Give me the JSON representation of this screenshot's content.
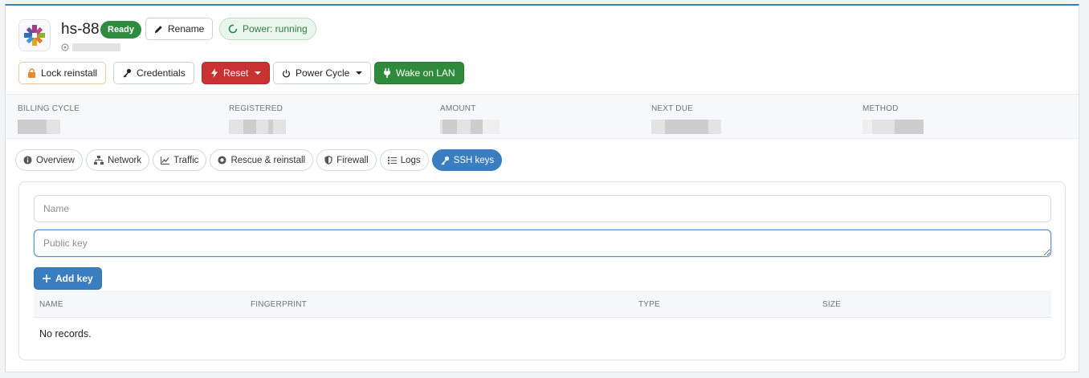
{
  "server": {
    "hostname": "hs-88",
    "status": "Ready",
    "rename_label": "Rename",
    "power_label": "Power: running"
  },
  "actions": {
    "lock_reinstall": "Lock reinstall",
    "credentials": "Credentials",
    "reset": "Reset",
    "power_cycle": "Power Cycle",
    "wake_on_lan": "Wake on LAN"
  },
  "billing": {
    "labels": [
      "BILLING CYCLE",
      "REGISTERED",
      "AMOUNT",
      "NEXT DUE",
      "METHOD"
    ]
  },
  "tabs": [
    "Overview",
    "Network",
    "Traffic",
    "Rescue & reinstall",
    "Firewall",
    "Logs",
    "SSH keys"
  ],
  "active_tab": "SSH keys",
  "ssh_form": {
    "name_placeholder": "Name",
    "key_placeholder": "Public key",
    "add_label": "Add key"
  },
  "table": {
    "columns": [
      "NAME",
      "FINGERPRINT",
      "TYPE",
      "SIZE"
    ],
    "empty_text": "No records."
  },
  "colors": {
    "accent": "#3a7dc0",
    "success": "#2e8b3f",
    "danger": "#c83232",
    "lock_border": "#f0c89a"
  },
  "icons": {
    "logo": "os-logo-icon",
    "rename": "pencil-icon",
    "power": "circle-spinner-icon",
    "lock": "lock-icon",
    "credentials": "key-icon",
    "reset": "bolt-icon",
    "power_cycle": "power-icon",
    "wake_on_lan": "plug-icon",
    "add": "plus-icon"
  }
}
